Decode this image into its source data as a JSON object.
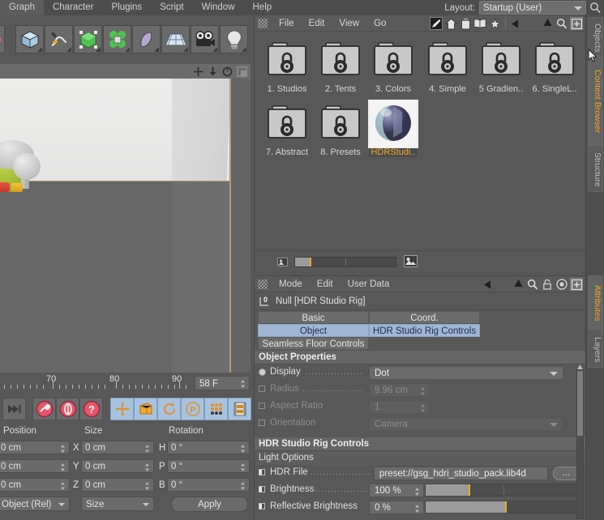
{
  "app": {
    "title": "Cinema 4D",
    "accent_orange": "#f0a81e",
    "accent_blue": "#9fb7d4",
    "panel_bg": "#585858"
  },
  "menubar": {
    "items": [
      "Graph",
      "Character",
      "Plugins",
      "Script",
      "Window",
      "Help"
    ],
    "layout_label": "Layout:",
    "layout_value": "Startup (User)",
    "search_icon": "search-icon"
  },
  "toolbar": {
    "buttons": [
      {
        "name": "undo-tool",
        "icon": "undo-icon"
      },
      {
        "name": "cube-primitive",
        "icon": "cube-icon"
      },
      {
        "name": "spline-pen",
        "icon": "pen-spline-icon"
      },
      {
        "name": "array-generator",
        "icon": "green-cube-icon"
      },
      {
        "name": "mograph-cloner",
        "icon": "cloner-icon"
      },
      {
        "name": "deformer",
        "icon": "bend-deformer-icon"
      },
      {
        "name": "scene-environment",
        "icon": "floor-grid-icon"
      },
      {
        "name": "camera-object",
        "icon": "camera-icon"
      },
      {
        "name": "light-object",
        "icon": "light-bulb-icon"
      }
    ]
  },
  "viewport": {
    "icons": [
      "move-view-icon",
      "scale-view-icon",
      "rotate-view-icon",
      "panel-layout-icon"
    ]
  },
  "timeline": {
    "ticks": [
      "70",
      "80",
      "90"
    ],
    "current_frame": "58 F"
  },
  "bottom_toolbar": {
    "buttons": [
      {
        "name": "go-to-end",
        "icon": "skip-end-icon",
        "selected": false
      },
      {
        "name": "record-position",
        "icon": "key-icon",
        "selected": false
      },
      {
        "name": "record-rotation",
        "icon": "rotation-key-icon",
        "selected": false
      },
      {
        "name": "record-parameter",
        "icon": "question-key-icon",
        "selected": false
      },
      {
        "name": "position-tool",
        "icon": "move-arrows-icon",
        "selected": true
      },
      {
        "name": "scale-tool",
        "icon": "scale-box-icon",
        "selected": true
      },
      {
        "name": "rotation-tool",
        "icon": "rotate-arrows-icon",
        "selected": true
      },
      {
        "name": "pla-tool",
        "icon": "p-circle-icon",
        "selected": true
      },
      {
        "name": "point-level-animation",
        "icon": "dots-grid-icon",
        "selected": true
      },
      {
        "name": "timeline-toggle",
        "icon": "film-strip-icon",
        "selected": true
      }
    ]
  },
  "coordinates": {
    "headers": [
      "Position",
      "Size",
      "Rotation"
    ],
    "position": [
      {
        "axis": "",
        "value": "0 cm"
      },
      {
        "axis": "",
        "value": "0 cm"
      },
      {
        "axis": "",
        "value": "0 cm"
      }
    ],
    "size": [
      {
        "axis": "X",
        "value": "0 cm"
      },
      {
        "axis": "Y",
        "value": "0 cm"
      },
      {
        "axis": "Z",
        "value": "0 cm"
      }
    ],
    "rotation": [
      {
        "axis": "H",
        "value": "0 °"
      },
      {
        "axis": "P",
        "value": "0 °"
      },
      {
        "axis": "B",
        "value": "0 °"
      }
    ],
    "mode_select": "Object (Rel)",
    "size_select": "Size",
    "apply_label": "Apply"
  },
  "content_browser": {
    "menus": [
      "File",
      "Edit",
      "View",
      "Go"
    ],
    "header_icons": [
      "pencil-icon",
      "home-icon",
      "preset-jar-icon",
      "book-icon",
      "star-icon",
      "back-arrow-icon",
      "up-arrow-icon",
      "search-icon",
      "new-folder-icon"
    ],
    "items": [
      {
        "label": "1. Studios",
        "icon": "locked-folder-icon",
        "selected": false
      },
      {
        "label": "2. Tents",
        "icon": "locked-folder-icon",
        "selected": false
      },
      {
        "label": "3. Colors",
        "icon": "locked-folder-icon",
        "selected": false
      },
      {
        "label": "4. Simple",
        "icon": "locked-folder-icon",
        "selected": false
      },
      {
        "label": "5 Gradien..",
        "icon": "locked-folder-icon",
        "selected": false
      },
      {
        "label": "6. SingleL..",
        "icon": "locked-folder-icon",
        "selected": false
      },
      {
        "label": "7. Abstract",
        "icon": "locked-folder-icon",
        "selected": false
      },
      {
        "label": "8. Presets",
        "icon": "locked-folder-icon",
        "selected": false
      },
      {
        "label": "HDRStudi..",
        "icon": "hdr-sphere-thumbnail",
        "selected": true
      }
    ],
    "footer": {
      "small_icon": "small-thumbnail-icon",
      "large_icon": "large-thumbnail-icon",
      "zoom_value": 14
    }
  },
  "attributes": {
    "menus": [
      "Mode",
      "Edit",
      "User Data"
    ],
    "header_icons": [
      "back-arrow-icon",
      "up-arrow-icon",
      "search-icon",
      "lock-icon",
      "target-icon",
      "new-tab-icon"
    ],
    "object_badge": "0",
    "object_title": "Null [HDR Studio Rig]",
    "tabs": [
      {
        "label": "Basic",
        "active": false
      },
      {
        "label": "Coord.",
        "active": false
      },
      {
        "label": "Object",
        "active": true
      },
      {
        "label": "HDR Studio Rig Controls",
        "active": true
      },
      {
        "label": "Seamless Floor Controls",
        "active": false
      }
    ],
    "object_properties": {
      "title": "Object Properties",
      "rows": [
        {
          "label": "Display",
          "value": "Dot",
          "type": "dropdown",
          "disabled": false,
          "marker": "radio"
        },
        {
          "label": "Radius",
          "value": "9.96 cm",
          "type": "number",
          "disabled": true,
          "marker": "checkbox"
        },
        {
          "label": "Aspect Ratio",
          "value": "1",
          "type": "number",
          "disabled": true,
          "marker": "checkbox"
        },
        {
          "label": "Orientation",
          "value": "Camera",
          "type": "dropdown",
          "disabled": true,
          "marker": "checkbox"
        }
      ]
    },
    "rig_controls": {
      "title": "HDR Studio Rig Controls",
      "subtitle": "Light Options",
      "rows": [
        {
          "label": "HDR File",
          "value": "preset://gsg_hdri_studio_pack.lib4d",
          "type": "file",
          "button": "...",
          "marker": "keyframe"
        },
        {
          "label": "Brightness",
          "value": "100 %",
          "type": "slider",
          "slider_pct": 28,
          "marker": "keyframe"
        },
        {
          "label": "Reflective Brightness",
          "value": "0 %",
          "type": "slider",
          "slider_pct": 52,
          "marker": "keyframe"
        }
      ]
    }
  },
  "vertical_tabs_top": [
    {
      "label": "Objects",
      "active": false
    },
    {
      "label": "Content Browser",
      "active": true
    },
    {
      "label": "Structure",
      "active": false
    }
  ],
  "vertical_tabs_bottom": [
    {
      "label": "Attributes",
      "active": true
    },
    {
      "label": "Layers",
      "active": false
    }
  ]
}
